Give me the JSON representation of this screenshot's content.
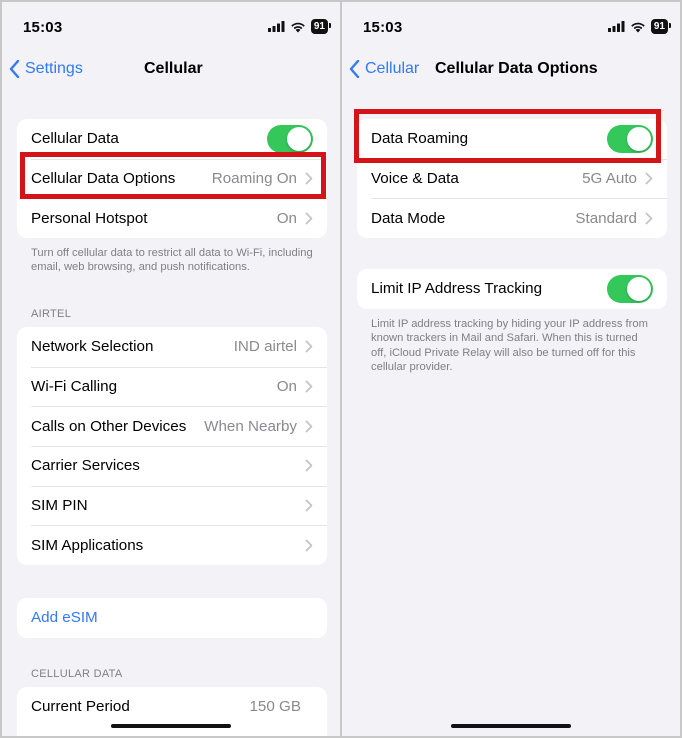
{
  "left": {
    "status": {
      "time": "15:03",
      "battery": "91"
    },
    "nav": {
      "back_label": "Settings",
      "title": "Cellular"
    },
    "group1": {
      "cellular_data_label": "Cellular Data",
      "cellular_data_on": true,
      "data_options_label": "Cellular Data Options",
      "data_options_value": "Roaming On",
      "hotspot_label": "Personal Hotspot",
      "hotspot_value": "On"
    },
    "group1_footer": "Turn off cellular data to restrict all data to Wi-Fi, including email, web browsing, and push notifications.",
    "airtel_header": "AIRTEL",
    "airtel_items": [
      {
        "label": "Network Selection",
        "value": "IND airtel"
      },
      {
        "label": "Wi-Fi Calling",
        "value": "On"
      },
      {
        "label": "Calls on Other Devices",
        "value": "When Nearby"
      },
      {
        "label": "Carrier Services",
        "value": ""
      },
      {
        "label": "SIM PIN",
        "value": ""
      },
      {
        "label": "SIM Applications",
        "value": ""
      }
    ],
    "esim_label": "Add eSIM",
    "cellular_data_header": "CELLULAR DATA",
    "current_period_label": "Current Period",
    "current_period_value": "150 GB"
  },
  "right": {
    "status": {
      "time": "15:03",
      "battery": "91"
    },
    "nav": {
      "back_label": "Cellular",
      "title": "Cellular Data Options"
    },
    "roaming_label": "Data Roaming",
    "roaming_on": true,
    "voice_label": "Voice & Data",
    "voice_value": "5G Auto",
    "mode_label": "Data Mode",
    "mode_value": "Standard",
    "limit_ip_label": "Limit IP Address Tracking",
    "limit_ip_on": true,
    "limit_ip_footer": "Limit IP address tracking by hiding your IP address from known trackers in Mail and Safari. When this is turned off, iCloud Private Relay will also be turned off for this cellular provider."
  },
  "colors": {
    "accent": "#3478f6",
    "toggle_on": "#34c759",
    "highlight": "#d5141a",
    "background": "#f2f2f7"
  },
  "icons": [
    "signal-icon",
    "wifi-icon",
    "battery-icon",
    "chevron-left-icon",
    "chevron-right-icon"
  ]
}
